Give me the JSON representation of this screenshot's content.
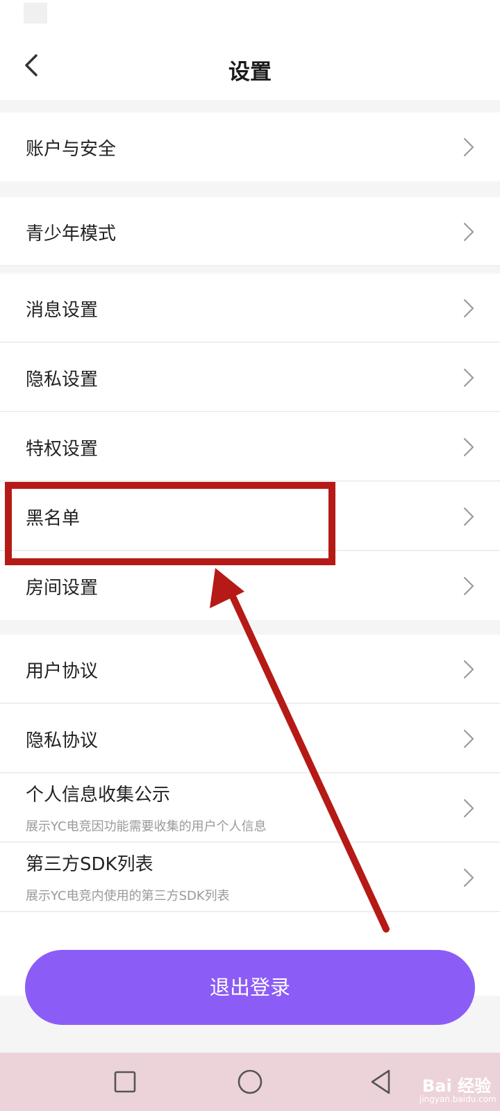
{
  "header": {
    "title": "设置"
  },
  "groups": [
    {
      "items": [
        {
          "label": "账户与安全"
        }
      ]
    },
    {
      "items": [
        {
          "label": "青少年模式"
        },
        {
          "label": "消息设置"
        },
        {
          "label": "隐私设置"
        },
        {
          "label": "特权设置"
        },
        {
          "label": "黑名单"
        },
        {
          "label": "房间设置"
        }
      ]
    },
    {
      "items": [
        {
          "label": "用户协议"
        },
        {
          "label": "隐私协议"
        },
        {
          "label": "个人信息收集公示",
          "sub": "展示YC电竞因功能需要收集的用户个人信息"
        },
        {
          "label": "第三方SDK列表",
          "sub": "展示YC电竞内使用的第三方SDK列表"
        }
      ]
    }
  ],
  "logout_label": "退出登录",
  "watermark": {
    "text": "Bai 经验",
    "sub": "jingyan.baidu.com"
  },
  "colors": {
    "accent": "#8c5cf6",
    "annotation": "#b51a16",
    "nav_bg": "#ecd3d9"
  }
}
